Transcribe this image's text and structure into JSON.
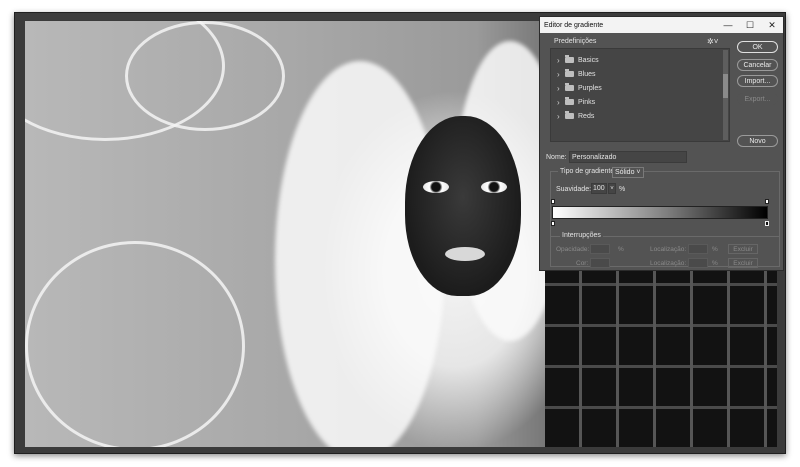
{
  "dialog": {
    "title": "Editor de gradiente",
    "window_controls": {
      "minimize": "—",
      "maximize": "☐",
      "close": "✕"
    },
    "presets": {
      "label": "Predefinições",
      "items": [
        {
          "label": "Basics"
        },
        {
          "label": "Blues"
        },
        {
          "label": "Purples"
        },
        {
          "label": "Pinks"
        },
        {
          "label": "Reds"
        }
      ]
    },
    "buttons": {
      "ok": "OK",
      "cancel": "Cancelar",
      "import": "Import...",
      "export": "Export...",
      "new": "Novo"
    },
    "name": {
      "label": "Nome:",
      "value": "Personalizado"
    },
    "gradient_type": {
      "label": "Tipo de gradiente:",
      "value": "Sólido"
    },
    "smoothness": {
      "label": "Suavidade:",
      "value": "100",
      "unit": "%"
    },
    "gradient": {
      "start_color": "#ffffff",
      "end_color": "#000000"
    },
    "stops": {
      "label": "Interrupções",
      "opacity_label": "Opacidade:",
      "color_label": "Cor:",
      "location_label": "Localização:",
      "percent": "%",
      "delete_label": "Excluir"
    }
  }
}
